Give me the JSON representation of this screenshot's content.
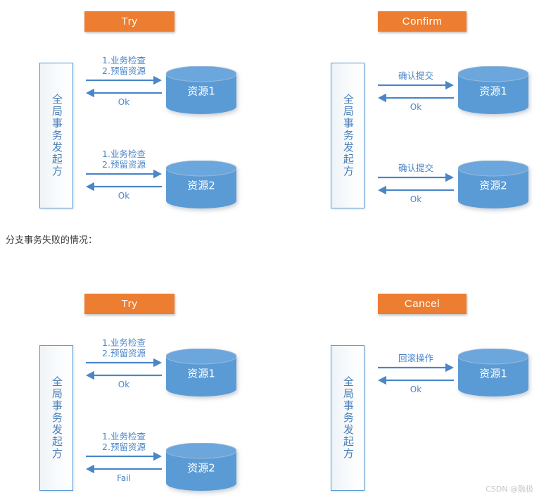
{
  "colors": {
    "accent_orange": "#ed7d31",
    "cylinder_blue": "#5b9bd5",
    "cylinder_top_blue": "#6ba6dc",
    "arrow_blue": "#4a86c8",
    "label_blue": "#4a7fb5",
    "box_border": "#5b9bd5",
    "note_text": "#3b3b3b",
    "watermark": "#c8c8c8",
    "background": "#ffffff"
  },
  "mid_note": {
    "text": "分支事务失败的情况："
  },
  "watermark": {
    "text": "CSDN @融极"
  },
  "initiator_label": "全局事务发起方",
  "captions": {
    "try_request_line1": "1.业务检查",
    "try_request_line2": "2.预留资源",
    "confirm_request": "确认提交",
    "cancel_request": "回滚操作",
    "ok": "Ok",
    "fail": "Fail"
  },
  "panels": [
    {
      "id": "try-success",
      "header": "Try",
      "initiator": "全局事务发起方",
      "flows": [
        {
          "resource": "资源1",
          "request_lines": [
            "1.业务检查",
            "2.预留资源"
          ],
          "response": "Ok"
        },
        {
          "resource": "资源2",
          "request_lines": [
            "1.业务检查",
            "2.预留资源"
          ],
          "response": "Ok"
        }
      ]
    },
    {
      "id": "confirm",
      "header": "Confirm",
      "initiator": "全局事务发起方",
      "flows": [
        {
          "resource": "资源1",
          "request_lines": [
            "确认提交"
          ],
          "response": "Ok"
        },
        {
          "resource": "资源2",
          "request_lines": [
            "确认提交"
          ],
          "response": "Ok"
        }
      ]
    },
    {
      "id": "try-fail",
      "header": "Try",
      "initiator": "全局事务发起方",
      "flows": [
        {
          "resource": "资源1",
          "request_lines": [
            "1.业务检查",
            "2.预留资源"
          ],
          "response": "Ok"
        },
        {
          "resource": "资源2",
          "request_lines": [
            "1.业务检查",
            "2.预留资源"
          ],
          "response": "Fail"
        }
      ]
    },
    {
      "id": "cancel",
      "header": "Cancel",
      "initiator": "全局事务发起方",
      "flows": [
        {
          "resource": "资源1",
          "request_lines": [
            "回滚操作"
          ],
          "response": "Ok"
        }
      ]
    }
  ]
}
